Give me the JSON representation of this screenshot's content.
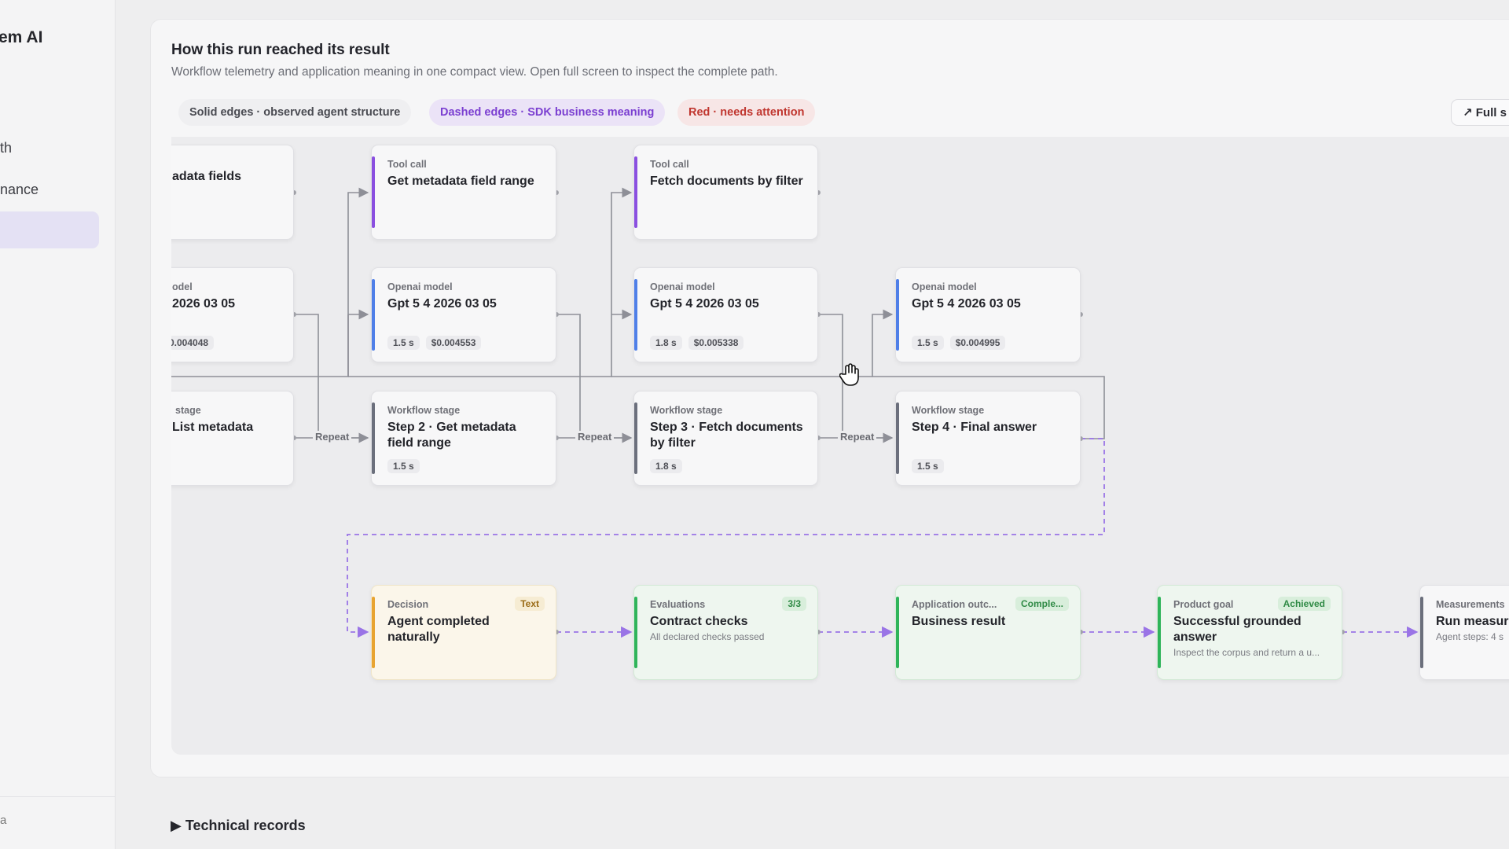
{
  "sidebar": {
    "brand": "em AI",
    "items": [
      "th",
      "nance"
    ],
    "footer": "a"
  },
  "panel": {
    "title": "How this run reached its result",
    "subtitle": "Workflow telemetry and application meaning in one compact view. Open full screen to inspect the complete path.",
    "legend": {
      "solid": "Solid edges · observed agent structure",
      "dashed": "Dashed edges · SDK business meaning",
      "red": "Red · needs attention"
    },
    "full_screen": "Full s",
    "full_screen_icon": "arrow-up-right-icon"
  },
  "colors": {
    "tool": "#8a4fe0",
    "model": "#4f7fe8",
    "stage": "#6b6f7c",
    "decision": "#e8a431",
    "success": "#2fb45a",
    "dashed_edge": "#9a74e6",
    "solid_edge": "#8e8f97"
  },
  "repeat_label": "Repeat",
  "nodes": {
    "tool0": {
      "kind": "",
      "title": "adata fields"
    },
    "tool1": {
      "kind": "Tool call",
      "title": "Get metadata field range"
    },
    "tool2": {
      "kind": "Tool call",
      "title": "Fetch documents by filter"
    },
    "model0": {
      "kind": "odel",
      "title": "2026 03 05",
      "chip2": "0.004048"
    },
    "model1": {
      "kind": "Openai model",
      "title": "Gpt 5 4 2026 03 05",
      "chip1": "1.5 s",
      "chip2": "$0.004553"
    },
    "model2": {
      "kind": "Openai model",
      "title": "Gpt 5 4 2026 03 05",
      "chip1": "1.8 s",
      "chip2": "$0.005338"
    },
    "model3": {
      "kind": "Openai model",
      "title": "Gpt 5 4 2026 03 05",
      "chip1": "1.5 s",
      "chip2": "$0.004995"
    },
    "stage0": {
      "kind": "stage",
      "title": "List metadata"
    },
    "stage1": {
      "kind": "Workflow stage",
      "title": "Step 2 · Get metadata field range",
      "chip1": "1.5 s"
    },
    "stage2": {
      "kind": "Workflow stage",
      "title": "Step 3 · Fetch documents by filter",
      "chip1": "1.8 s"
    },
    "stage3": {
      "kind": "Workflow stage",
      "title": "Step 4 · Final answer",
      "chip1": "1.5 s"
    },
    "decision": {
      "kind": "Decision",
      "badge": "Text",
      "title": "Agent completed naturally"
    },
    "evaluations": {
      "kind": "Evaluations",
      "badge": "3/3",
      "title": "Contract checks",
      "sub": "All declared checks passed"
    },
    "outcome": {
      "kind": "Application outc...",
      "badge": "Comple...",
      "title": "Business result"
    },
    "goal": {
      "kind": "Product goal",
      "badge": "Achieved",
      "title": "Successful grounded answer",
      "sub": "Inspect the corpus and return a u..."
    },
    "measure": {
      "kind": "Measurements",
      "title": "Run measur",
      "sub": "Agent steps: 4 s"
    }
  },
  "technical_records": "Technical records"
}
